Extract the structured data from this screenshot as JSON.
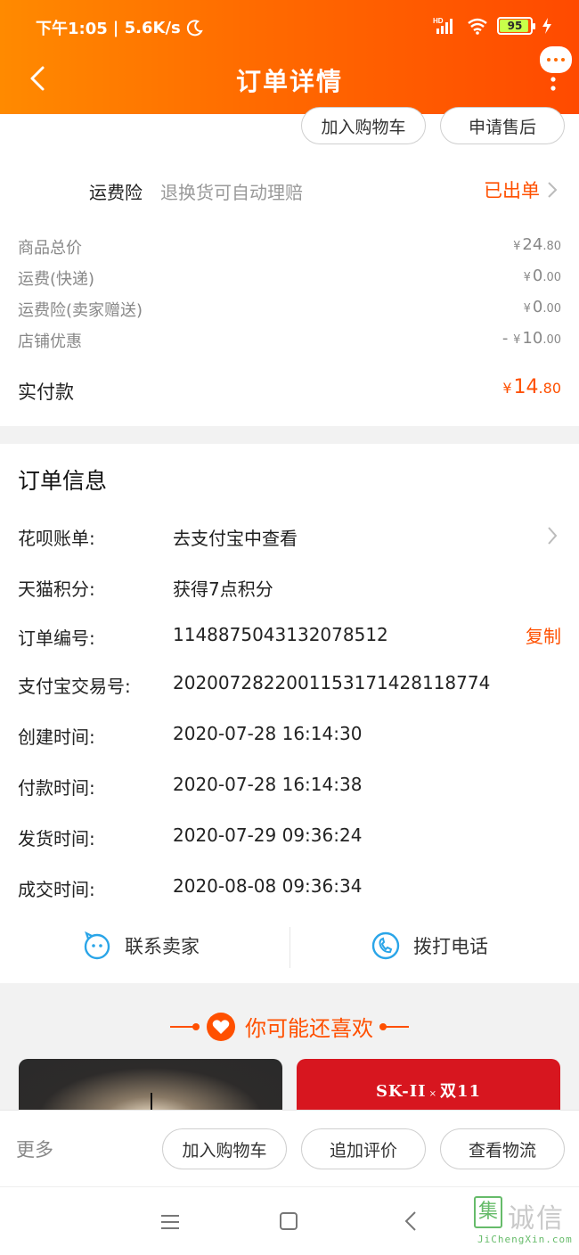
{
  "status_bar": {
    "time": "下午1:05",
    "speed": "| 5.6K/s",
    "network": "HD",
    "battery": "95"
  },
  "header": {
    "title": "订单详情"
  },
  "top_actions": {
    "add_cart": "加入购物车",
    "after_sale": "申请售后"
  },
  "insurance": {
    "label": "运费险",
    "desc": "退换货可自动理赔",
    "status": "已出单"
  },
  "price_rows": [
    {
      "label": "商品总价",
      "sign": "",
      "yen": "¥",
      "int": "24",
      "dec": ".80"
    },
    {
      "label": "运费(快递)",
      "sign": "",
      "yen": "¥",
      "int": "0",
      "dec": ".00"
    },
    {
      "label": "运费险(卖家赠送)",
      "sign": "",
      "yen": "¥",
      "int": "0",
      "dec": ".00"
    },
    {
      "label": "店铺优惠",
      "sign": "- ",
      "yen": "¥",
      "int": "10",
      "dec": ".00"
    }
  ],
  "paid": {
    "label": "实付款",
    "yen": "¥",
    "int": "14",
    "dec": ".80"
  },
  "order_info": {
    "title": "订单信息",
    "rows": [
      {
        "key": "花呗账单:",
        "value": "去支付宝中查看"
      },
      {
        "key": "天猫积分:",
        "value": "获得7点积分"
      },
      {
        "key": "订单编号:",
        "value": "1148875043132078512",
        "action": "复制"
      },
      {
        "key": "支付宝交易号:",
        "value": "2020072822001153171428118774"
      },
      {
        "key": "创建时间:",
        "value": "2020-07-28 16:14:30"
      },
      {
        "key": "付款时间:",
        "value": "2020-07-28 16:14:38"
      },
      {
        "key": "发货时间:",
        "value": "2020-07-29 09:36:24"
      },
      {
        "key": "成交时间:",
        "value": "2020-08-08 09:36:34"
      }
    ]
  },
  "contact": {
    "seller": "联系卖家",
    "phone": "拨打电话"
  },
  "recommend": {
    "title": "你可能还喜欢",
    "right_brand": "SK-II",
    "right_x": "×",
    "right_event": "双11"
  },
  "bottom_actions": {
    "more": "更多",
    "add_cart": "加入购物车",
    "review": "追加评价",
    "logistics": "查看物流"
  },
  "watermark": {
    "box": "集",
    "text": "诚信",
    "url": "JiChengXin.com"
  },
  "colors": {
    "accent": "#ff5000",
    "header_start": "#ff8a00",
    "header_end": "#ff4a00"
  }
}
